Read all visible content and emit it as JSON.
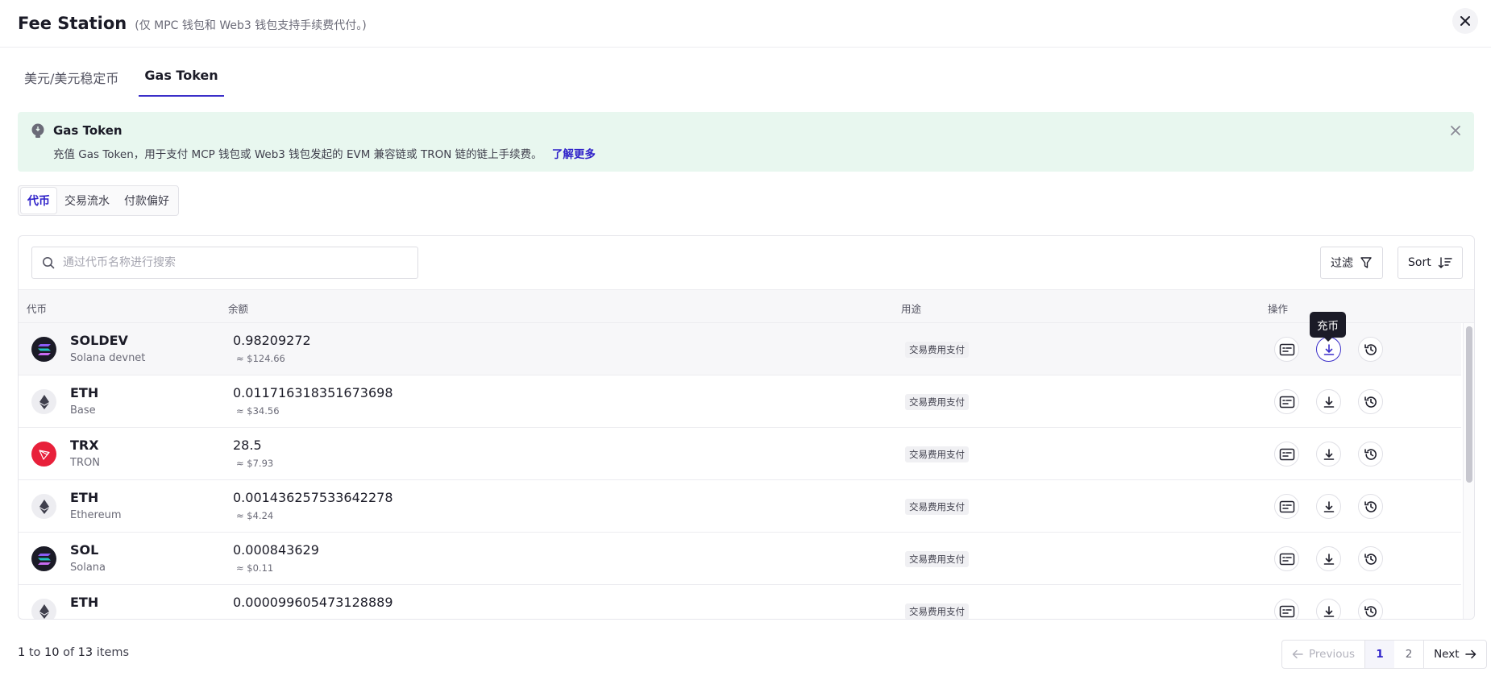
{
  "header": {
    "title": "Fee Station",
    "subtitle": "(仅 MPC 钱包和 Web3 钱包支持手续费代付。)"
  },
  "top_tabs": [
    {
      "label": "美元/美元稳定币"
    },
    {
      "label": "Gas Token"
    }
  ],
  "banner": {
    "title": "Gas Token",
    "description": "充值 Gas Token，用于支付 MCP 钱包或 Web3 钱包发起的 EVM 兼容链或 TRON 链的链上手续费。",
    "link": "了解更多"
  },
  "segments": [
    {
      "label": "代币"
    },
    {
      "label": "交易流水"
    },
    {
      "label": "付款偏好"
    }
  ],
  "search": {
    "placeholder": "通过代币名称进行搜索"
  },
  "toolbar": {
    "filter_label": "过滤",
    "sort_label": "Sort"
  },
  "table": {
    "columns": {
      "token": "代币",
      "balance": "余额",
      "usage": "用途",
      "actions": "操作"
    },
    "rows": [
      {
        "symbol": "SOLDEV",
        "network": "Solana devnet",
        "amount": "0.98209272",
        "usd": "≈ $124.66",
        "usage": "交易费用支付",
        "icon": "solana-icon"
      },
      {
        "symbol": "ETH",
        "network": "Base",
        "amount": "0.011716318351673698",
        "usd": "≈ $34.56",
        "usage": "交易费用支付",
        "icon": "ethereum-icon"
      },
      {
        "symbol": "TRX",
        "network": "TRON",
        "amount": "28.5",
        "usd": "≈ $7.93",
        "usage": "交易费用支付",
        "icon": "tron-icon"
      },
      {
        "symbol": "ETH",
        "network": "Ethereum",
        "amount": "0.001436257533642278",
        "usd": "≈ $4.24",
        "usage": "交易费用支付",
        "icon": "ethereum-icon"
      },
      {
        "symbol": "SOL",
        "network": "Solana",
        "amount": "0.000843629",
        "usd": "≈ $0.11",
        "usage": "交易费用支付",
        "icon": "solana-icon"
      },
      {
        "symbol": "ETH",
        "network": "",
        "amount": "0.000099605473128889",
        "usd": "",
        "usage": "交易费用支付",
        "icon": "ethereum-icon"
      }
    ]
  },
  "tooltip": {
    "text": "充币"
  },
  "pagination": {
    "from": "1",
    "to_word": "to",
    "to": "10",
    "of_word": "of",
    "total": "13",
    "items_word": "items",
    "prev_label": "Previous",
    "pages": [
      "1",
      "2"
    ],
    "next_label": "Next"
  },
  "colors": {
    "accent": "#3b2fc9",
    "banner_bg": "#e8f7ef",
    "tron_red": "#e8203a"
  }
}
